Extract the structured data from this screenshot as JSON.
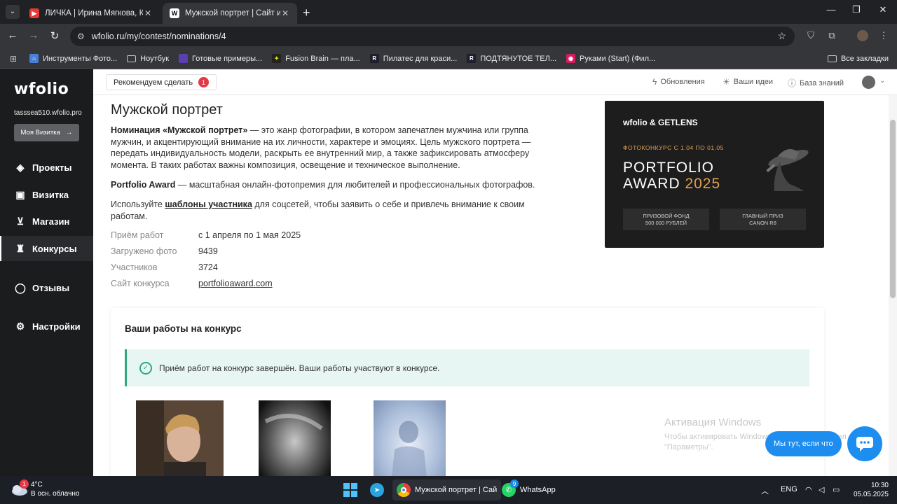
{
  "browser": {
    "tabs": [
      {
        "title": "ЛИЧКА | Ирина Мягкова, Карт",
        "favicon": "youtube-icon",
        "active": false
      },
      {
        "title": "Мужской портрет | Сайт и обл",
        "favicon": "wfolio-icon",
        "active": true
      }
    ],
    "url": "wfolio.ru/my/contest/nominations/4",
    "bookmarks": [
      "Инструменты Фото...",
      "Ноутбук",
      "Готовые примеры...",
      "Fusion Brain — пла...",
      "Пилатес для краси...",
      "ПОДТЯНУТОЕ ТЕЛ...",
      "Руками (Start) (Фил..."
    ],
    "all_bookmarks": "Все закладки"
  },
  "sidebar": {
    "logo": "wfolio",
    "site": "tasssea510.wfolio.pro",
    "my_card_button": "Моя Визитка",
    "items": [
      {
        "label": "Проекты",
        "icon": "stack-icon"
      },
      {
        "label": "Визитка",
        "icon": "id-card-icon"
      },
      {
        "label": "Магазин",
        "icon": "cart-icon"
      },
      {
        "label": "Конкурсы",
        "icon": "trophy-icon"
      },
      {
        "label": "Отзывы",
        "icon": "chat-icon"
      },
      {
        "label": "Настройки",
        "icon": "gear-icon"
      }
    ]
  },
  "header": {
    "recommend_label": "Рекомендуем сделать",
    "recommend_count": "1",
    "updates": "Обновления",
    "ideas": "Ваши идеи",
    "knowledge": "База знаний"
  },
  "main": {
    "title": "Мужской портрет",
    "p1_bold": "Номинация «Мужской портрет»",
    "p1_rest": " — это жанр фотографии, в котором запечатлен мужчина или группа мужчин, и акцентирующий внимание на их личности, характере и эмоциях. Цель мужского портрета — передать индивидуальность модели, раскрыть ее внутренний мир, а также зафиксировать атмосферу момента. В таких работах важны композиция, освещение и техническое выполнение.",
    "p2_bold": "Portfolio Award",
    "p2_rest": " — масштабная онлайн-фотопремия для любителей и профессиональных фотографов.",
    "p3_start": "Используйте ",
    "p3_link": "шаблоны участника",
    "p3_end": " для соцсетей, чтобы заявить о себе и привлечь внимание к своим работам.",
    "info": [
      {
        "k": "Приём работ",
        "v": "с 1 апреля по 1 мая 2025"
      },
      {
        "k": "Загружено фото",
        "v": "9439"
      },
      {
        "k": "Участников",
        "v": "3724"
      },
      {
        "k": "Сайт конкурса",
        "v": "portfolioaward.com"
      }
    ]
  },
  "banner": {
    "logo": "wfolio & GETLENS",
    "dates": "ФОТОКОНКУРС С 1.04 ПО 01.05",
    "line1": "PORTFOLIO",
    "line2": "AWARD",
    "year": "2025",
    "prize1": "ПРИЗОВОЙ ФОНД\n500 000 РУБЛЕЙ",
    "prize2": "ГЛАВНЫЙ ПРИЗ\nCANON R8"
  },
  "works": {
    "title": "Ваши работы на конкурс",
    "notice": "Приём работ на конкурс завершён. Ваши работы участвуют в конкурсе."
  },
  "overlay": {
    "activation_title": "Активация Windows",
    "activation_text": "Чтобы активировать Windows, перейдите в раздел \"Параметры\".",
    "chat_pill": "Мы тут, если что"
  },
  "taskbar": {
    "temp": "4°C",
    "weather": "В осн. облачно",
    "weather_badge": "1",
    "chrome_title": "Мужской портрет | Сай",
    "whatsapp": "WhatsApp",
    "whatsapp_badge": "9",
    "lang": "ENG",
    "time": "10:30",
    "date": "05.05.2025"
  }
}
